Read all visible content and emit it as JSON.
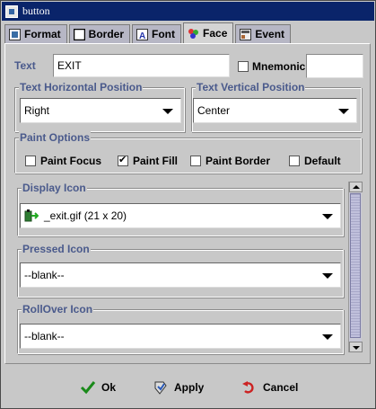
{
  "window": {
    "title": "button"
  },
  "tabs": [
    {
      "label": "Format",
      "icon": "format-icon"
    },
    {
      "label": "Border",
      "icon": "border-icon"
    },
    {
      "label": "Font",
      "icon": "font-icon"
    },
    {
      "label": "Face",
      "icon": "face-icon",
      "active": true
    },
    {
      "label": "Event",
      "icon": "event-icon"
    }
  ],
  "text": {
    "label": "Text",
    "value": "EXIT"
  },
  "mnemonic": {
    "label": "Mnemonic",
    "checked": false,
    "value": ""
  },
  "text_h_pos": {
    "legend": "Text Horizontal Position",
    "value": "Right"
  },
  "text_v_pos": {
    "legend": "Text Vertical Position",
    "value": "Center"
  },
  "paint_options": {
    "legend": "Paint Options",
    "items": [
      {
        "label": "Paint Focus",
        "checked": false
      },
      {
        "label": "Paint Fill",
        "checked": true
      },
      {
        "label": "Paint Border",
        "checked": false
      },
      {
        "label": "Default",
        "checked": false
      }
    ]
  },
  "display_icon": {
    "legend": "Display Icon",
    "value": "_exit.gif  (21 x 20)"
  },
  "pressed_icon": {
    "legend": "Pressed Icon",
    "value": "--blank--"
  },
  "rollover_icon": {
    "legend": "RollOver Icon",
    "value": "--blank--"
  },
  "buttons": {
    "ok": "Ok",
    "apply": "Apply",
    "cancel": "Cancel"
  },
  "colors": {
    "legend": "#4a5a8c",
    "titlebar": "#0a246a",
    "ok_check": "#1a8a1a",
    "cancel_arrow": "#cc2222"
  }
}
